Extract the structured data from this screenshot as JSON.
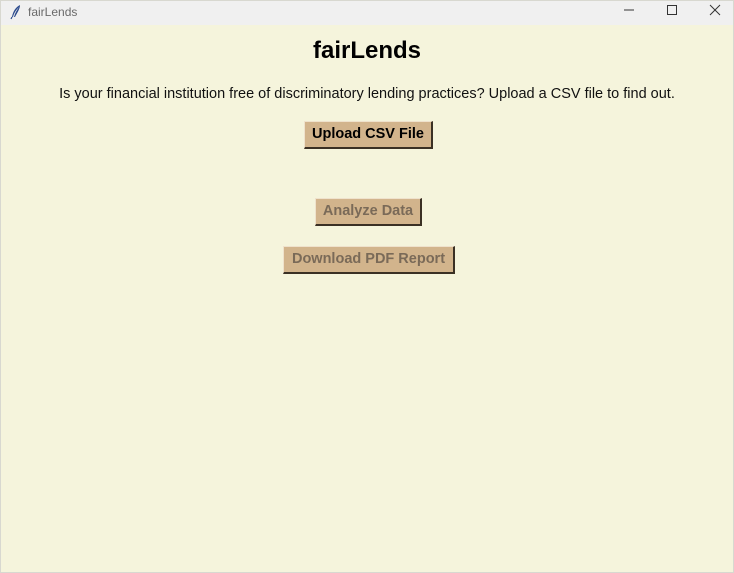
{
  "window": {
    "title": "fairLends"
  },
  "main": {
    "heading": "fairLends",
    "subtitle": "Is your financial institution free of discriminatory lending practices? Upload a CSV file to find out.",
    "upload_label": "Upload CSV File",
    "analyze_label": "Analyze Data",
    "download_label": "Download PDF Report"
  },
  "colors": {
    "background": "#f5f4dc",
    "button": "#d2b48c",
    "disabled_text": "#7a6a58"
  },
  "icons": {
    "app": "feather-icon",
    "minimize": "minimize-icon",
    "maximize": "maximize-icon",
    "close": "close-icon"
  }
}
